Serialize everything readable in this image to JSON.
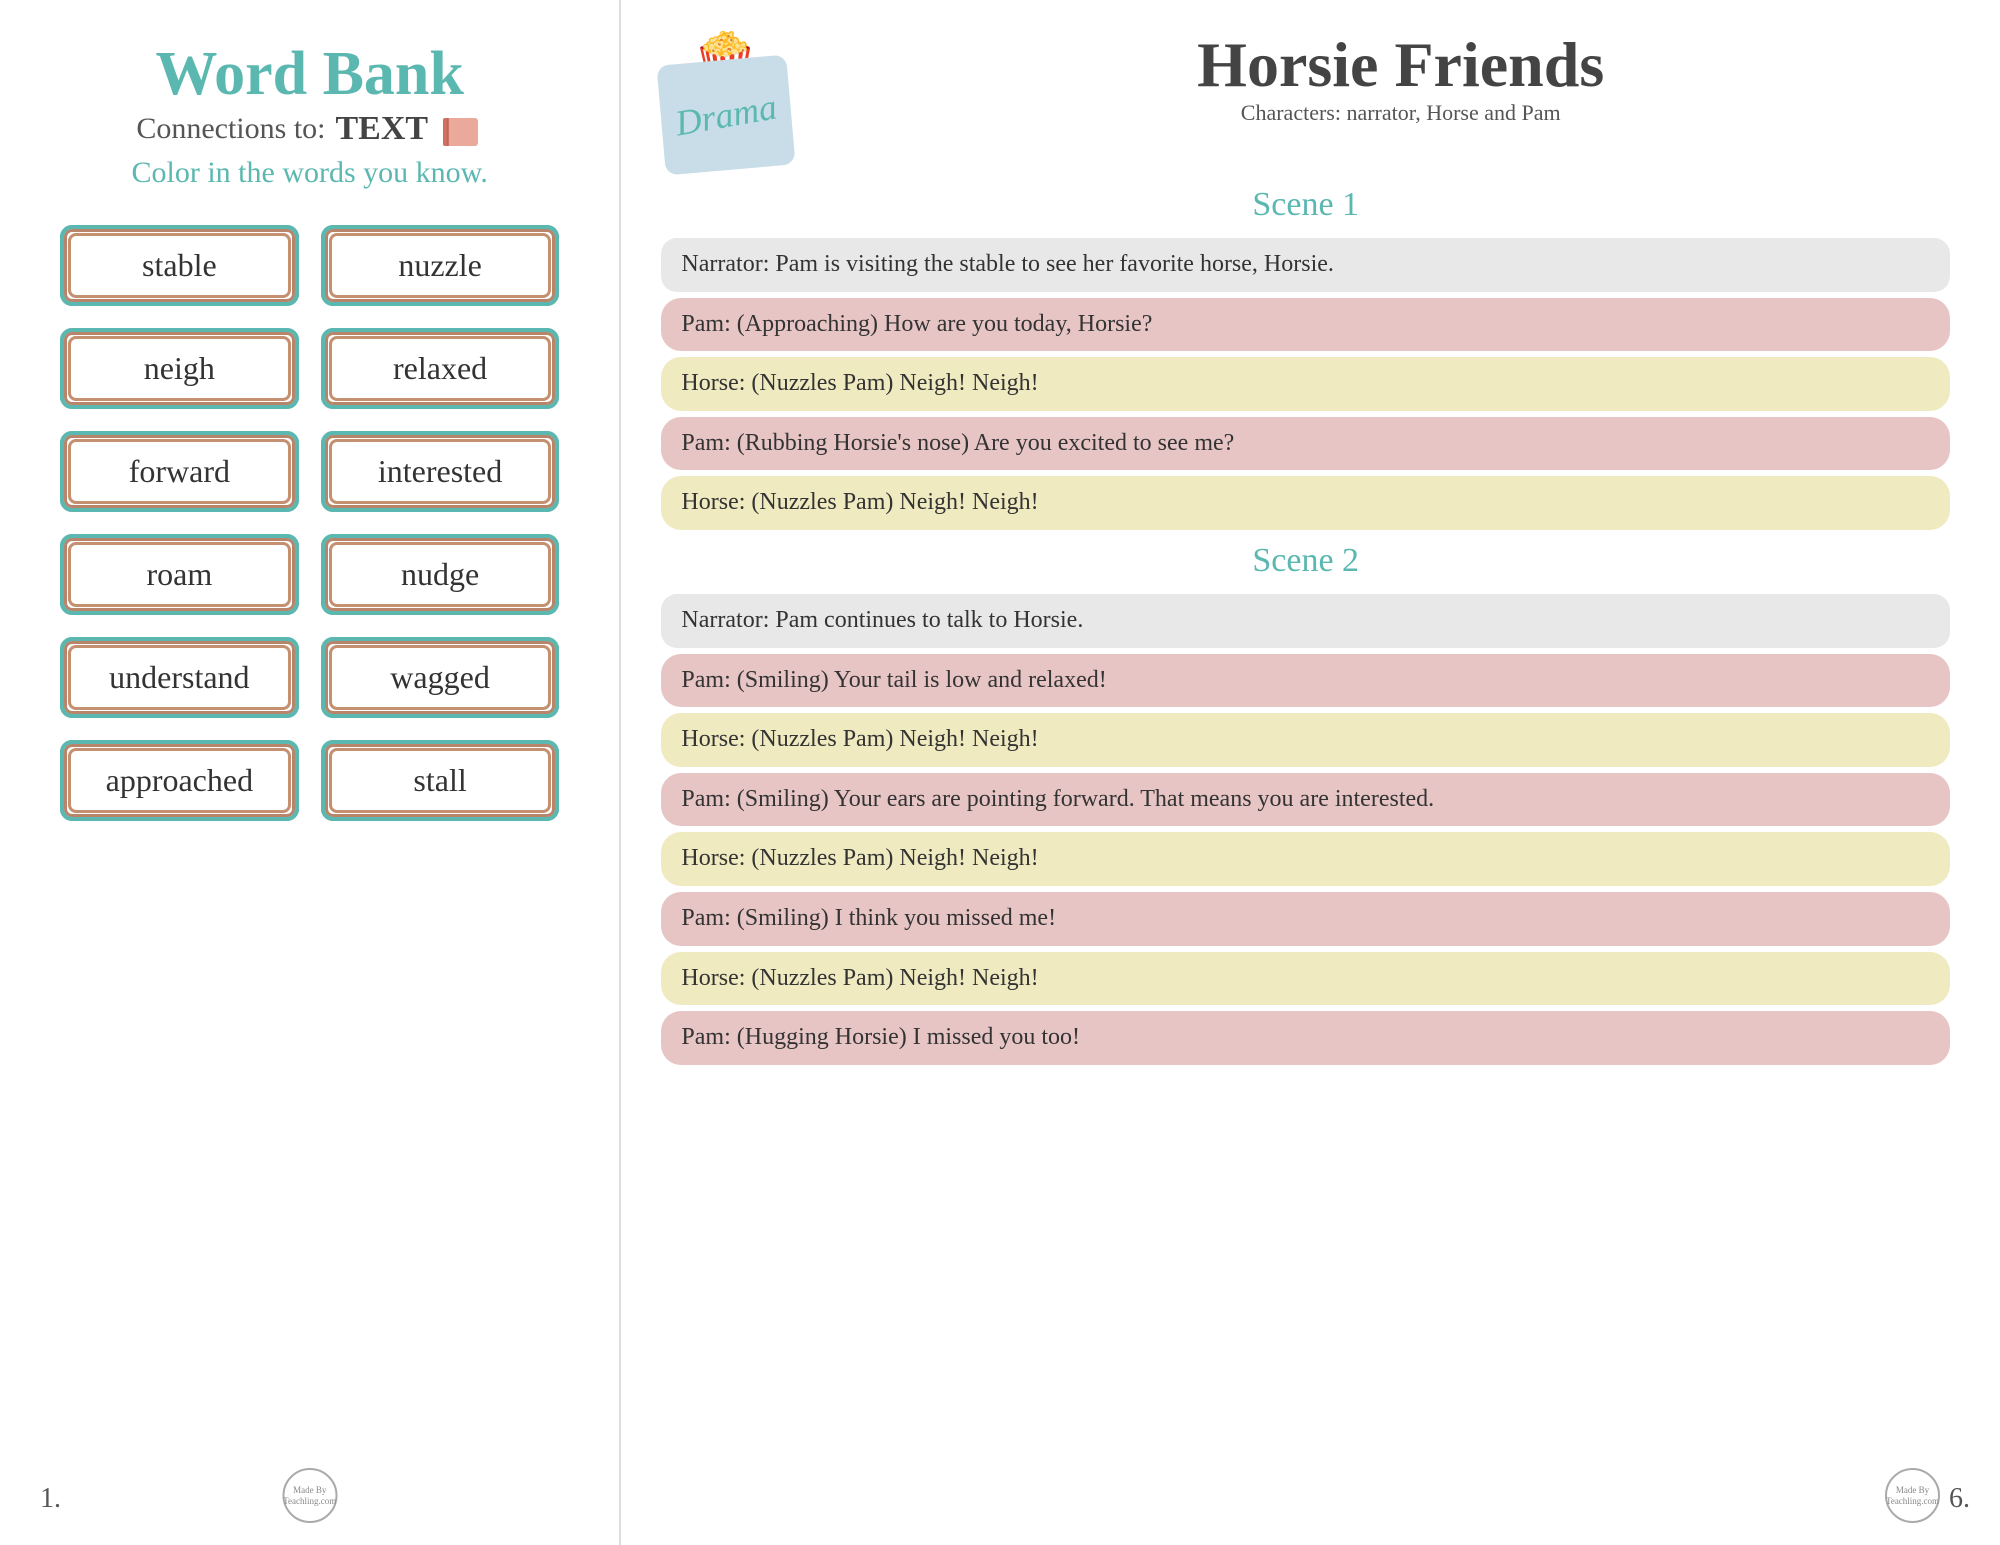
{
  "left": {
    "title": "Word Bank",
    "connections_label": "Connections to:",
    "connections_value": "TEXT",
    "color_instruction": "Color in the words you know.",
    "words": [
      {
        "word": "stable"
      },
      {
        "word": "nuzzle"
      },
      {
        "word": "neigh"
      },
      {
        "word": "relaxed"
      },
      {
        "word": "forward"
      },
      {
        "word": "interested"
      },
      {
        "word": "roam"
      },
      {
        "word": "nudge"
      },
      {
        "word": "understand"
      },
      {
        "word": "wagged"
      },
      {
        "word": "approached"
      },
      {
        "word": "stall"
      }
    ],
    "page_number": "1.",
    "logo_text": "Made By\nTeachling.com"
  },
  "right": {
    "drama_label": "Drama",
    "title": "Horsie Friends",
    "characters": "Characters: narrator, Horse and Pam",
    "scenes": [
      {
        "scene_label": "Scene 1",
        "dialogues": [
          {
            "type": "narrator",
            "text": "Narrator:  Pam is visiting the stable to see her favorite horse, Horsie."
          },
          {
            "type": "pam",
            "text": "Pam: (Approaching) How are you today, Horsie?"
          },
          {
            "type": "horse",
            "text": "Horse: (Nuzzles Pam) Neigh! Neigh!"
          },
          {
            "type": "pam",
            "text": "Pam: (Rubbing Horsie's nose) Are you excited to see me?"
          },
          {
            "type": "horse",
            "text": "Horse: (Nuzzles Pam) Neigh! Neigh!"
          }
        ]
      },
      {
        "scene_label": "Scene 2",
        "dialogues": [
          {
            "type": "narrator",
            "text": "Narrator: Pam continues to talk to Horsie."
          },
          {
            "type": "pam",
            "text": "Pam: (Smiling) Your tail is low and relaxed!"
          },
          {
            "type": "horse",
            "text": "Horse: (Nuzzles Pam) Neigh! Neigh!"
          },
          {
            "type": "pam",
            "text": "Pam: (Smiling) Your ears are pointing forward. That means you are interested."
          },
          {
            "type": "horse",
            "text": "Horse: (Nuzzles Pam) Neigh! Neigh!"
          },
          {
            "type": "pam",
            "text": "Pam: (Smiling) I think you missed me!"
          },
          {
            "type": "horse",
            "text": "Horse: (Nuzzles Pam) Neigh! Neigh!"
          },
          {
            "type": "pam",
            "text": "Pam: (Hugging Horsie) I missed you too!"
          }
        ]
      }
    ],
    "page_number": "6.",
    "logo_text": "Made By\nTeachling.com"
  }
}
